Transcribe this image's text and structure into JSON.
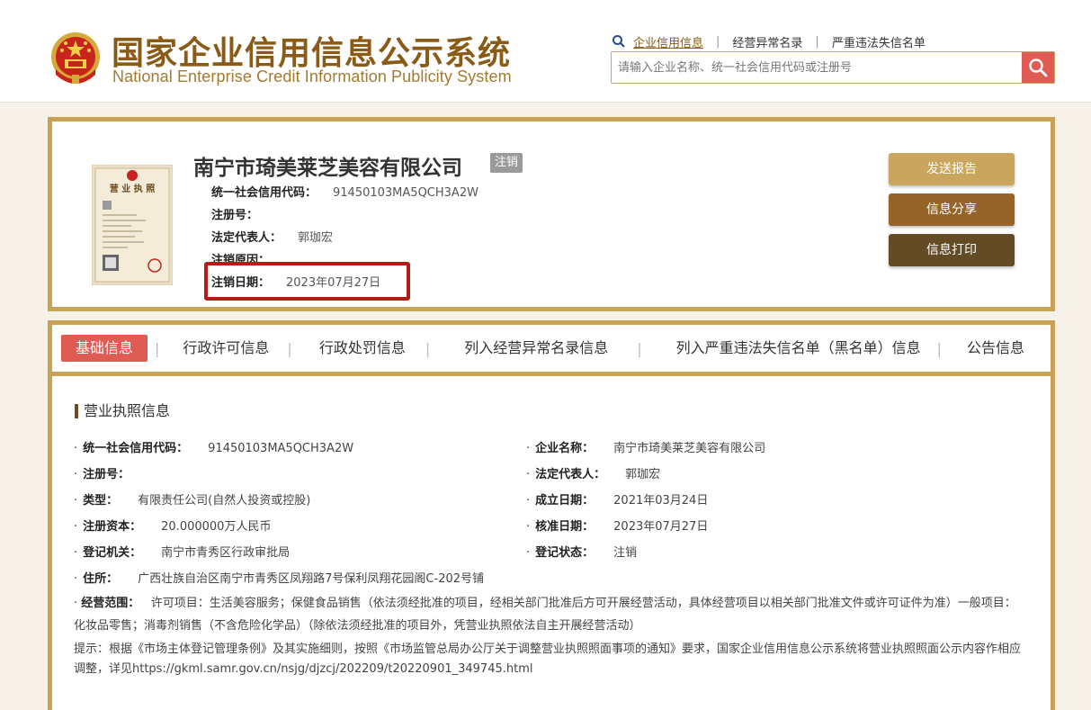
{
  "header": {
    "title_cn": "国家企业信用信息公示系统",
    "title_en": "National Enterprise Credit Information Publicity System",
    "emblem_icon": "national-emblem-icon",
    "nav": [
      {
        "label": "企业信用信息"
      },
      {
        "label": "经营异常名录"
      },
      {
        "label": "严重违法失信名单"
      }
    ],
    "search": {
      "placeholder": "请输入企业名称、统一社会信用代码或注册号",
      "value": ""
    }
  },
  "company": {
    "name": "南宁市琦美莱芝美容有限公司",
    "status": "注销",
    "fields": [
      {
        "label": "统一社会信用代码：",
        "value": "91450103MA5QCH3A2W"
      },
      {
        "label": "注册号：",
        "value": ""
      },
      {
        "label": "法定代表人：",
        "value": "郭珈宏"
      },
      {
        "label": "注销原因：",
        "value": ""
      },
      {
        "label": "注销日期：",
        "value": "2023年07月27日"
      }
    ],
    "actions": [
      {
        "label": "发送报告"
      },
      {
        "label": "信息分享"
      },
      {
        "label": "信息打印"
      }
    ]
  },
  "tabs": [
    {
      "label": "基础信息"
    },
    {
      "label": "行政许可信息"
    },
    {
      "label": "行政处罚信息"
    },
    {
      "label": "列入经营异常名录信息"
    },
    {
      "label": "列入严重违法失信名单（黑名单）信息"
    },
    {
      "label": "公告信息"
    }
  ],
  "license_section": {
    "title": "营业执照信息",
    "left": [
      {
        "label": "统一社会信用代码：",
        "value": "91450103MA5QCH3A2W"
      },
      {
        "label": "注册号：",
        "value": ""
      },
      {
        "label": "类型：",
        "value": "有限责任公司(自然人投资或控股)"
      },
      {
        "label": "注册资本：",
        "value": "20.000000万人民币"
      },
      {
        "label": "登记机关：",
        "value": "南宁市青秀区行政审批局"
      },
      {
        "label": "住所：",
        "value": "广西壮族自治区南宁市青秀区凤翔路7号保利凤翔花园阁C-202号铺"
      }
    ],
    "right": [
      {
        "label": "企业名称：",
        "value": "南宁市琦美莱芝美容有限公司"
      },
      {
        "label": "法定代表人：",
        "value": "郭珈宏"
      },
      {
        "label": "成立日期：",
        "value": "2021年03月24日"
      },
      {
        "label": "核准日期：",
        "value": "2023年07月27日"
      },
      {
        "label": "登记状态：",
        "value": "注销"
      }
    ],
    "scope_label": "经营范围：",
    "scope_value": "许可项目：生活美容服务；保健食品销售（依法须经批准的项目，经相关部门批准后方可开展经营活动，具体经营项目以相关部门批准文件或许可证件为准）一般项目：化妆品零售；消毒剂销售（不含危险化学品）（除依法须经批准的项目外，凭营业执照依法自主开展经营活动）",
    "note": "提示：根据《市场主体登记管理条例》及其实施细则，按照《市场监管总局办公厅关于调整营业执照照面事项的通知》要求，国家企业信用信息公示系统将营业执照照面公示内容作相应调整，详见https://gkml.samr.gov.cn/nsjg/djzcj/202209/t20220901_349745.html"
  },
  "colors": {
    "brand_gold": "#caa254",
    "brand_brown": "#8a5a17",
    "accent_red": "#e05b53",
    "highlight_red": "#b21d14"
  }
}
